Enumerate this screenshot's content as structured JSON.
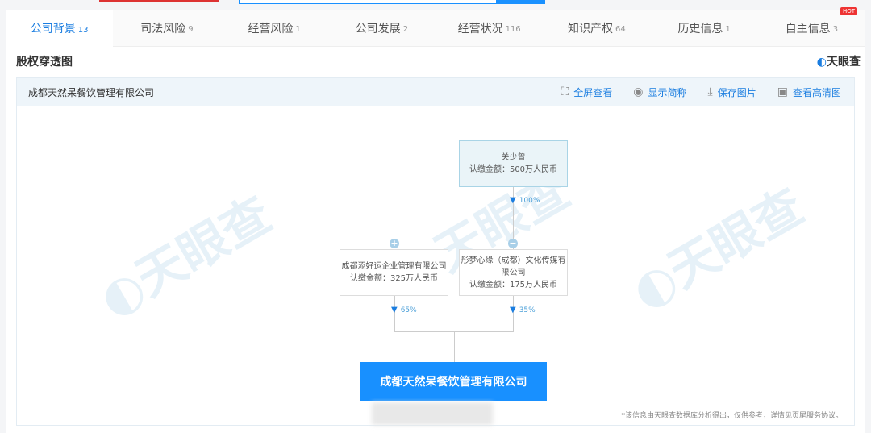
{
  "tabs": [
    {
      "label": "公司背景",
      "count": "13"
    },
    {
      "label": "司法风险",
      "count": "9"
    },
    {
      "label": "经营风险",
      "count": "1"
    },
    {
      "label": "公司发展",
      "count": "2"
    },
    {
      "label": "经营状况",
      "count": "116"
    },
    {
      "label": "知识产权",
      "count": "64"
    },
    {
      "label": "历史信息",
      "count": "1"
    },
    {
      "label": "自主信息",
      "count": "3",
      "badge": "HOT"
    }
  ],
  "section_title": "股权穿透图",
  "logo": "天眼查",
  "panel": {
    "company": "成都天然呆餐饮管理有限公司",
    "tools": [
      {
        "icon": "fullscreen-icon",
        "label": "全屏查看"
      },
      {
        "icon": "eye-icon",
        "label": "显示简称"
      },
      {
        "icon": "download-icon",
        "label": "保存图片"
      },
      {
        "icon": "image-icon",
        "label": "查看高清图"
      }
    ]
  },
  "chart": {
    "shareholder": {
      "name": "关少曾",
      "amount": "认缴金额：500万人民币",
      "pct": "100%"
    },
    "left": {
      "name": "成都添好运企业管理有限公司",
      "amount": "认缴金额：325万人民币",
      "pct": "65%"
    },
    "right": {
      "name": "彤梦心缘（成都）文化传媒有限公司",
      "amount": "认缴金额：175万人民币",
      "pct": "35%"
    },
    "target": "成都天然呆餐饮管理有限公司"
  },
  "disclaimer": "*该信息由天眼查数据库分析得出，仅供参考，详情见页尾服务协议。",
  "colors": {
    "accent": "#1890ff"
  }
}
